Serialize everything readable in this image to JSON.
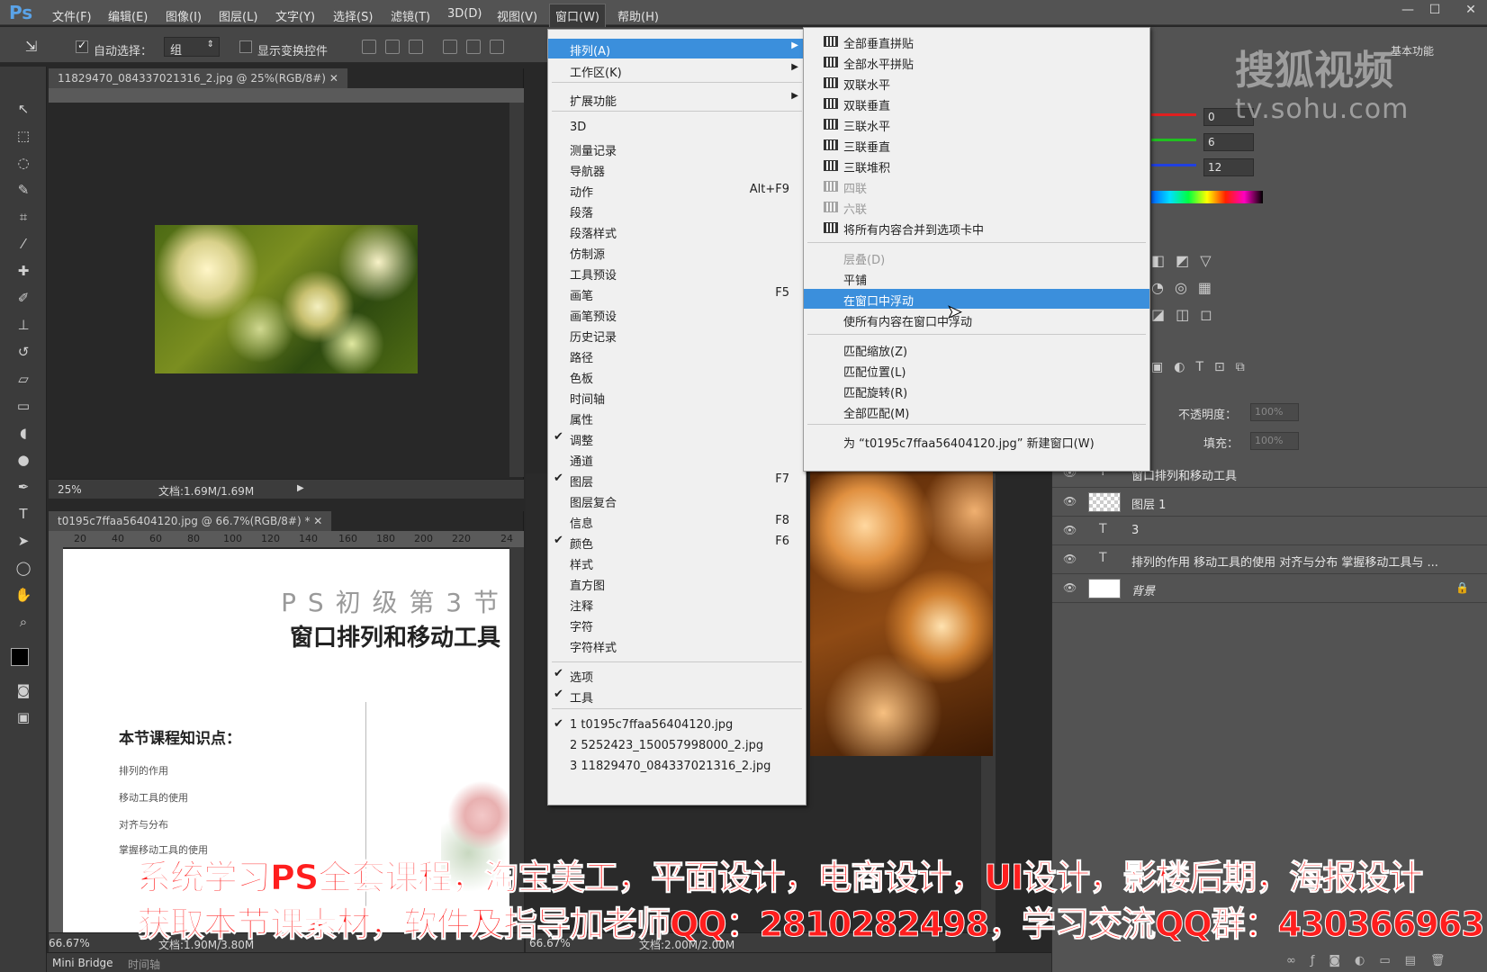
{
  "app": {
    "logo": "Ps"
  },
  "menubar": {
    "items": [
      "文件(F)",
      "编辑(E)",
      "图像(I)",
      "图层(L)",
      "文字(Y)",
      "选择(S)",
      "滤镜(T)",
      "3D(D)",
      "视图(V)",
      "窗口(W)",
      "帮助(H)"
    ]
  },
  "window_controls": {
    "minimize": "—",
    "maximize": "☐",
    "close": "✕"
  },
  "options": {
    "auto_select_label": "自动选择：",
    "auto_select_value": "组",
    "show_transform_label": "显示变换控件"
  },
  "docs": {
    "doc1_tab": "11829470_084337021316_2.jpg @ 25%(RGB/8#)",
    "doc1_zoom": "25%",
    "doc1_size": "文档:1.69M/1.69M",
    "doc2_tab": "t0195c7ffaa56404120.jpg @ 66.7%(RGB/8#) *",
    "doc2_zoom": "66.67%",
    "doc2_size": "文档:1.90M/3.80M",
    "doc3_zoom": "66.67%",
    "doc3_size": "文档:2.00M/2.00M",
    "ruler_ticks": [
      "20",
      "40",
      "60",
      "80",
      "100",
      "120",
      "140",
      "160",
      "180",
      "200",
      "220",
      "24"
    ]
  },
  "canvas_text": {
    "title_line1": "P S 初 级 第 3 节",
    "title_line2": "窗口排列和移动工具",
    "kp_heading": "本节课程知识点：",
    "kp1": "排列的作用",
    "kp2": "移动工具的使用",
    "kp3": "对齐与分布",
    "kp4": "掌握移动工具的使用"
  },
  "window_menu": {
    "items": [
      {
        "label": "排列(A)",
        "sub": true,
        "highlight": true
      },
      {
        "label": "工作区(K)",
        "sub": true
      },
      {
        "label": "扩展功能",
        "sub": true
      },
      {
        "label": "3D"
      },
      {
        "label": "测量记录"
      },
      {
        "label": "导航器"
      },
      {
        "label": "动作",
        "shortcut": "Alt+F9"
      },
      {
        "label": "段落"
      },
      {
        "label": "段落样式"
      },
      {
        "label": "仿制源"
      },
      {
        "label": "工具预设"
      },
      {
        "label": "画笔",
        "shortcut": "F5"
      },
      {
        "label": "画笔预设"
      },
      {
        "label": "历史记录"
      },
      {
        "label": "路径"
      },
      {
        "label": "色板"
      },
      {
        "label": "时间轴"
      },
      {
        "label": "属性"
      },
      {
        "label": "调整",
        "checked": true
      },
      {
        "label": "通道"
      },
      {
        "label": "图层",
        "checked": true,
        "shortcut": "F7"
      },
      {
        "label": "图层复合"
      },
      {
        "label": "信息",
        "shortcut": "F8"
      },
      {
        "label": "颜色",
        "checked": true,
        "shortcut": "F6"
      },
      {
        "label": "样式"
      },
      {
        "label": "直方图"
      },
      {
        "label": "注释"
      },
      {
        "label": "字符"
      },
      {
        "label": "字符样式"
      },
      {
        "label": "选项",
        "checked": true
      },
      {
        "label": "工具",
        "checked": true
      },
      {
        "label": "1 t0195c7ffaa56404120.jpg",
        "checked": true
      },
      {
        "label": "2 5252423_150057998000_2.jpg"
      },
      {
        "label": "3 11829470_084337021316_2.jpg"
      }
    ]
  },
  "arrange_menu": {
    "items": [
      {
        "label": "全部垂直拼贴",
        "icon": true
      },
      {
        "label": "全部水平拼贴",
        "icon": true
      },
      {
        "label": "双联水平",
        "icon": true
      },
      {
        "label": "双联垂直",
        "icon": true
      },
      {
        "label": "三联水平",
        "icon": true
      },
      {
        "label": "三联垂直",
        "icon": true
      },
      {
        "label": "三联堆积",
        "icon": true
      },
      {
        "label": "四联",
        "icon": true,
        "disabled": true
      },
      {
        "label": "六联",
        "icon": true,
        "disabled": true
      },
      {
        "label": "将所有内容合并到选项卡中",
        "icon": true
      },
      {
        "label": "层叠(D)",
        "disabled": true
      },
      {
        "label": "平铺"
      },
      {
        "label": "在窗口中浮动",
        "highlight": true
      },
      {
        "label": "使所有内容在窗口中浮动"
      },
      {
        "label": "匹配缩放(Z)"
      },
      {
        "label": "匹配位置(L)"
      },
      {
        "label": "匹配旋转(R)"
      },
      {
        "label": "全部匹配(M)"
      },
      {
        "label": "为 “t0195c7ffaa56404120.jpg” 新建窗口(W)"
      }
    ]
  },
  "panel": {
    "workspace": "基本功能",
    "rgb_values": [
      "0",
      "6",
      "12"
    ],
    "opacity_label": "不透明度：",
    "opacity_value": "100%",
    "fill_label": "填充：",
    "fill_value": "100%",
    "layers": [
      {
        "name": "窗口排列和移动工具",
        "type": "T"
      },
      {
        "name": "图层 1",
        "type": "thumb"
      },
      {
        "name": "3",
        "type": "T"
      },
      {
        "name": "排列的作用 移动工具的使用 对齐与分布 掌握移动工具与 ...",
        "type": "T"
      },
      {
        "name": "背景",
        "type": "bg"
      }
    ]
  },
  "watermark": {
    "brand": "搜狐视频",
    "url": "tv.sohu.com"
  },
  "overlay": {
    "line1": "系统学习PS全套课程，淘宝美工，平面设计，电商设计，UI设计，影楼后期，海报设计",
    "line2": "获取本节课素材，软件及指导加老师QQ：2810282498，学习交流QQ群：430366963"
  },
  "bottom": {
    "mini_bridge": "Mini Bridge",
    "timeline": "时间轴"
  },
  "colors": {
    "menu_highlight": "#3b8fdc",
    "overlay_red": "#ff1e1e",
    "ps_blue": "#5aa3e8"
  }
}
